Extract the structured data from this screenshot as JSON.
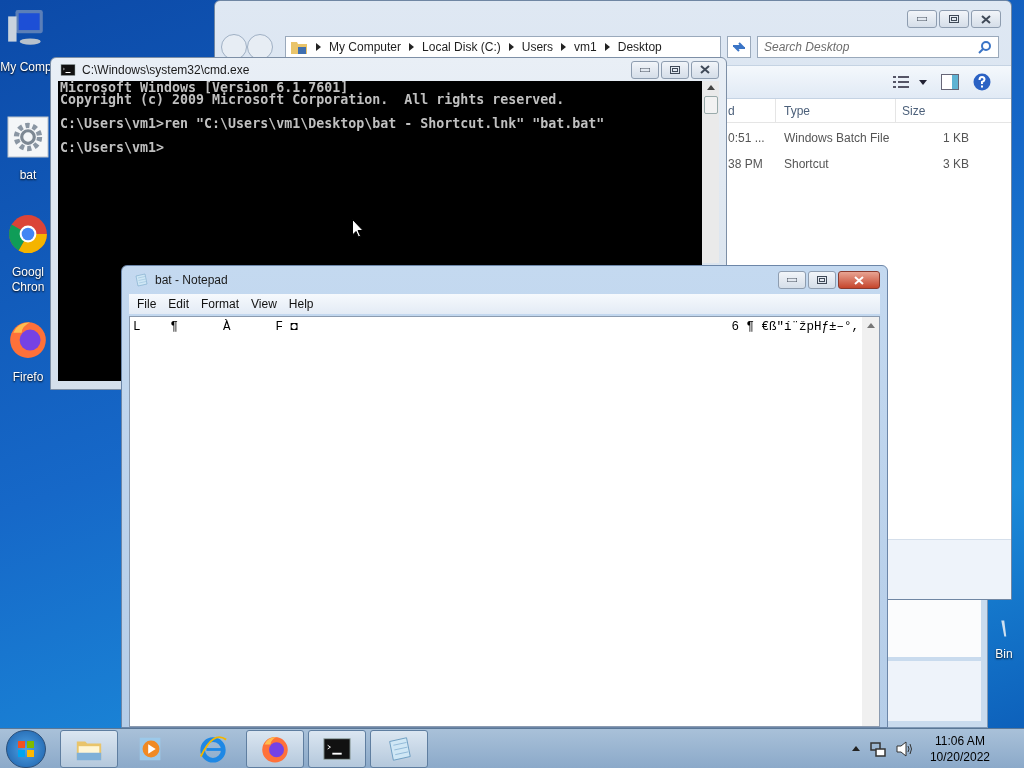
{
  "desktop": {
    "icons": [
      {
        "kind": "computer",
        "lines": [
          "My Comp"
        ]
      },
      {
        "kind": "batch",
        "lines": [
          "bat"
        ]
      },
      {
        "kind": "chrome",
        "lines": [
          "Googl",
          "Chron"
        ]
      },
      {
        "kind": "firefox",
        "lines": [
          "Firefo"
        ]
      },
      {
        "kind": "recycle",
        "lines": [
          "Bin"
        ]
      }
    ]
  },
  "explorer": {
    "active": false,
    "breadcrumbs": [
      "My Computer",
      "Local Disk (C:)",
      "Users",
      "vm1",
      "Desktop"
    ],
    "search": {
      "placeholder": "Search Desktop"
    },
    "columns": [
      "d",
      "Type",
      "Size"
    ],
    "rows": [
      [
        "0:51 ...",
        "Windows Batch File",
        "1 KB"
      ],
      [
        "38 PM",
        "Shortcut",
        "3 KB"
      ]
    ]
  },
  "cmd": {
    "title": "C:\\Windows\\system32\\cmd.exe",
    "active": false,
    "blocks": [
      [
        "Microsoft Windows [Version 6.1.7601]",
        "Copyright (c) 2009 Microsoft Corporation.  All rights reserved."
      ],
      [
        "C:\\Users\\vm1>ren \"C:\\Users\\vm1\\Desktop\\bat - Shortcut.lnk\" \"bat.bat\""
      ],
      [
        "C:\\Users\\vm1>"
      ]
    ]
  },
  "notepad": {
    "title": "bat - Notepad",
    "active": true,
    "menu": [
      "File",
      "Edit",
      "Format",
      "View",
      "Help"
    ],
    "text_left": "L    ¶      À      F ◘",
    "text_right": "6 ¶ €ß\"í¨žpHƒ±–°,"
  },
  "taskbar": {
    "apps": [
      {
        "kind": "explorer",
        "running": true
      },
      {
        "kind": "media",
        "running": false
      },
      {
        "kind": "ie",
        "running": false
      },
      {
        "kind": "firefox",
        "running": true
      },
      {
        "kind": "cmd",
        "running": true
      },
      {
        "kind": "notepad",
        "running": true
      }
    ],
    "clock": {
      "time": "11:06 AM",
      "date": "10/20/2022"
    }
  }
}
